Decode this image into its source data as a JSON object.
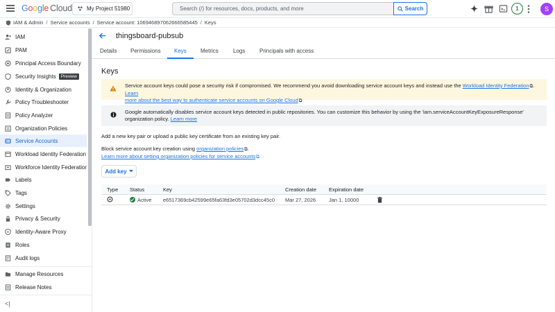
{
  "header": {
    "logo_g": "G",
    "logo_o1": "o",
    "logo_o2": "o",
    "logo_g2": "g",
    "logo_l": "l",
    "logo_e": "e",
    "logo_cloud": "Cloud",
    "project": "My Project 51980",
    "search_placeholder": "Search (/) for resources, docs, products, and more",
    "search_button": "Search",
    "notification_count": "1",
    "avatar_letter": "S"
  },
  "breadcrumb": {
    "items": [
      "IAM & Admin",
      "Service accounts",
      "Service account: 106946897062666585445",
      "Keys"
    ]
  },
  "sidebar": {
    "items": [
      {
        "label": "IAM",
        "icon": "person-add-icon"
      },
      {
        "label": "PAM",
        "icon": "shield-icon"
      },
      {
        "label": "Principal Access Boundary",
        "icon": "boundary-icon"
      },
      {
        "label": "Security Insights",
        "badge": "Preview",
        "icon": "insights-icon"
      },
      {
        "label": "Identity & Organization",
        "icon": "account-circle-icon"
      },
      {
        "label": "Policy Troubleshooter",
        "icon": "wrench-icon"
      },
      {
        "label": "Policy Analyzer",
        "icon": "policy-analyzer-icon"
      },
      {
        "label": "Organization Policies",
        "icon": "list-icon"
      },
      {
        "label": "Service Accounts",
        "icon": "service-account-icon",
        "active": true
      },
      {
        "label": "Workload Identity Federation",
        "icon": "federation-icon"
      },
      {
        "label": "Workforce Identity Federation",
        "icon": "workforce-icon"
      },
      {
        "label": "Labels",
        "icon": "label-icon"
      },
      {
        "label": "Tags",
        "icon": "tag-icon"
      },
      {
        "label": "Settings",
        "icon": "gear-icon"
      },
      {
        "label": "Privacy & Security",
        "icon": "lock-icon"
      },
      {
        "label": "Identity-Aware Proxy",
        "icon": "proxy-icon"
      },
      {
        "label": "Roles",
        "icon": "roles-icon"
      },
      {
        "label": "Audit logs",
        "icon": "audit-icon"
      }
    ],
    "bottom_items": [
      {
        "label": "Manage Resources",
        "icon": "folder-icon"
      },
      {
        "label": "Release Notes",
        "icon": "notes-icon"
      }
    ],
    "collapse": "<|"
  },
  "page": {
    "title": "thingsboard-pubsub",
    "tabs": [
      "Details",
      "Permissions",
      "Keys",
      "Metrics",
      "Logs",
      "Principals with access"
    ],
    "active_tab": "Keys",
    "section_title": "Keys"
  },
  "warning": {
    "text1": "Service account keys could pose a security risk if compromised. We recommend you avoid downloading service account keys and instead use the ",
    "link1": "Workload Identity Federation",
    "text2": ". ",
    "link2a": "Learn",
    "link2b": "more about the best way to authenticate service accounts on Google Cloud",
    "ext": "⧉"
  },
  "info": {
    "text1": "Google automatically disables service account keys detected in public repositories. You can customize this behavior by using the 'iam.serviceAccountKeyExposureResponse'",
    "text2": "organization policy. ",
    "link": "Learn more"
  },
  "body": {
    "para1": "Add a new key pair or upload a public key certificate from an existing key pair.",
    "para2_text": "Block service account key creation using ",
    "para2_link": "organization policies",
    "para2_end": ".",
    "para3_link": "Learn more about setting organization policies for service accounts",
    "add_key": "Add key"
  },
  "table": {
    "headers": [
      "Type",
      "Status",
      "Key",
      "Creation date",
      "Expiration date"
    ],
    "rows": [
      {
        "type_icon": "key-type-icon",
        "status": "Active",
        "key": "e6517369cb42599e65fa63fd3e05702d3dcc45c0",
        "created": "Mar 27, 2026",
        "expires": "Jan 1, 10000"
      }
    ]
  },
  "colors": {
    "accent": "#1a73e8",
    "active_bg": "#e8f0fe",
    "warning_bg": "#fef7e0",
    "info_bg": "#f1f3f4",
    "status_green": "#188038",
    "avatar": "#a142f4"
  }
}
